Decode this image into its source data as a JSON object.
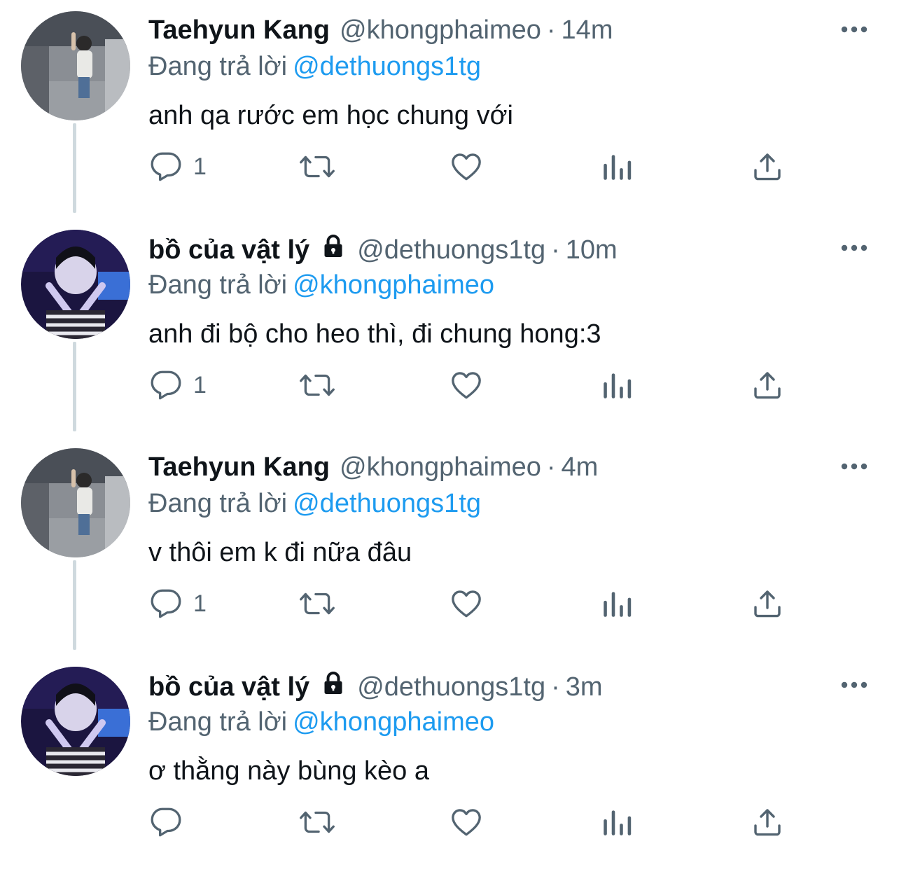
{
  "colors": {
    "text": "#0f1419",
    "secondary": "#536471",
    "mention": "#1d9bf0",
    "thread_line": "#cfd9de"
  },
  "tweets": [
    {
      "name": "Taehyun Kang",
      "locked": false,
      "handle": "@khongphaimeo",
      "separator": "·",
      "time": "14m",
      "reply_prefix": "Đang trả lời",
      "reply_to": "@dethuongs1tg",
      "text": "anh qa rước em học chung với",
      "reply_count": "1",
      "avatar_icon": "user-photo-avatar"
    },
    {
      "name": "bồ của vật lý",
      "locked": true,
      "handle": "@dethuongs1tg",
      "separator": "·",
      "time": "10m",
      "reply_prefix": "Đang trả lời",
      "reply_to": "@khongphaimeo",
      "text": "anh đi bộ cho heo thì, đi chung hong:3",
      "reply_count": "1",
      "avatar_icon": "user-photo-avatar"
    },
    {
      "name": "Taehyun Kang",
      "locked": false,
      "handle": "@khongphaimeo",
      "separator": "·",
      "time": "4m",
      "reply_prefix": "Đang trả lời",
      "reply_to": "@dethuongs1tg",
      "text": "v thôi em k đi nữa đâu",
      "reply_count": "1",
      "avatar_icon": "user-photo-avatar"
    },
    {
      "name": "bồ của vật lý",
      "locked": true,
      "handle": "@dethuongs1tg",
      "separator": "·",
      "time": "3m",
      "reply_prefix": "Đang trả lời",
      "reply_to": "@khongphaimeo",
      "text": "ơ thằng này bùng kèo a",
      "reply_count": "",
      "avatar_icon": "user-photo-avatar"
    }
  ],
  "icons": {
    "more": "more-dots-icon",
    "reply": "reply-bubble-icon",
    "retweet": "retweet-icon",
    "like": "heart-icon",
    "views": "bar-chart-icon",
    "share": "share-icon",
    "lock": "lock-icon"
  }
}
